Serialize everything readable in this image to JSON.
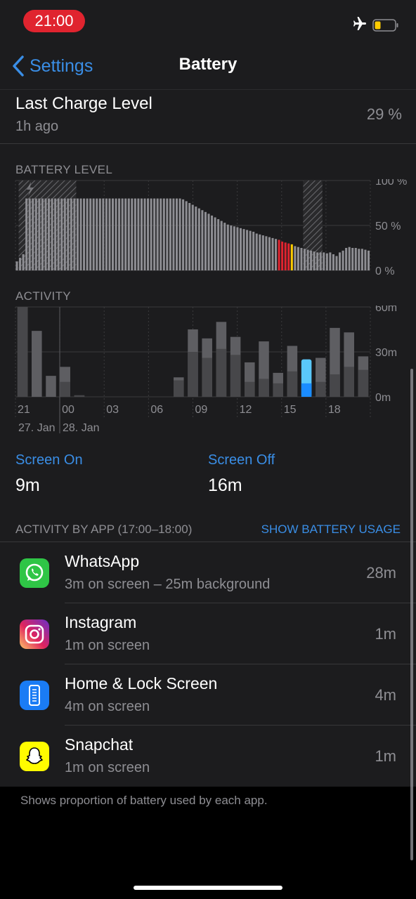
{
  "status": {
    "time": "21:00"
  },
  "nav": {
    "back_label": "Settings",
    "title": "Battery"
  },
  "last_charge": {
    "title": "Last Charge Level",
    "subtitle": "1h ago",
    "value": "29 %"
  },
  "battery_level": {
    "label": "BATTERY LEVEL",
    "y_ticks": [
      "100 %",
      "50 %",
      "0 %"
    ],
    "normal_color": "#8e8e93",
    "low_color": "#e0242f",
    "low_accent_color": "#ffcc00"
  },
  "activity": {
    "label": "ACTIVITY",
    "y_ticks": [
      "60m",
      "30m",
      "0m"
    ],
    "x_labels": [
      "21",
      "00",
      "03",
      "06",
      "09",
      "12",
      "15",
      "18"
    ],
    "date_labels": [
      "27. Jan",
      "28. Jan"
    ],
    "highlight_color": "#5ac8fa",
    "highlight_dark_color": "#1a8cff"
  },
  "chart_data": [
    {
      "type": "bar",
      "title": "BATTERY LEVEL",
      "ylim": [
        0,
        100
      ],
      "y_ticks": [
        "100 %",
        "50 %",
        "0 %"
      ],
      "values": [
        10,
        14,
        18,
        80,
        80,
        80,
        80,
        80,
        80,
        80,
        80,
        80,
        80,
        80,
        80,
        80,
        80,
        80,
        80,
        80,
        80,
        80,
        80,
        80,
        80,
        80,
        80,
        80,
        80,
        80,
        80,
        80,
        80,
        80,
        80,
        80,
        80,
        80,
        80,
        80,
        80,
        80,
        80,
        80,
        80,
        80,
        80,
        80,
        80,
        80,
        80,
        80,
        79,
        77,
        75,
        73,
        71,
        69,
        67,
        65,
        63,
        61,
        59,
        57,
        55,
        53,
        51,
        50,
        49,
        48,
        47,
        46,
        45,
        44,
        43,
        41,
        40,
        39,
        38,
        37,
        36,
        35,
        34,
        32,
        31,
        30,
        29,
        27,
        26,
        25,
        24,
        23,
        22,
        21,
        20,
        20,
        20,
        19,
        20,
        18,
        16,
        20,
        22,
        25,
        26,
        25,
        25,
        24,
        24,
        23,
        22
      ],
      "charging_ranges": [
        [
          1,
          18
        ],
        [
          90,
          95
        ]
      ],
      "low_range": [
        82,
        86
      ]
    },
    {
      "type": "bar",
      "title": "ACTIVITY",
      "ylim": [
        0,
        60
      ],
      "y_ticks": [
        "60m",
        "30m",
        "0m"
      ],
      "x_tick_labels": [
        "21",
        "00",
        "03",
        "06",
        "09",
        "12",
        "15",
        "18"
      ],
      "series": [
        {
          "name": "Screen On",
          "values": [
            60,
            0,
            0,
            10,
            1,
            0,
            0,
            0,
            0,
            0,
            0,
            11,
            30,
            26,
            32,
            28,
            10,
            12,
            9,
            17,
            0,
            10,
            15,
            20,
            18
          ]
        },
        {
          "name": "Screen Off",
          "values": [
            0,
            44,
            14,
            10,
            0,
            0,
            0,
            0,
            0,
            0,
            0,
            2,
            15,
            13,
            18,
            12,
            13,
            25,
            7,
            17,
            0,
            16,
            31,
            23,
            9
          ]
        }
      ],
      "highlighted_hour_index": 20,
      "highlighted_hour": {
        "on": 9,
        "off": 16
      }
    }
  ],
  "screen_on": {
    "label": "Screen On",
    "value": "9m"
  },
  "screen_off": {
    "label": "Screen Off",
    "value": "16m"
  },
  "activity_by_app": {
    "label": "ACTIVITY BY APP (17:00–18:00)",
    "action": "SHOW BATTERY USAGE",
    "apps": [
      {
        "name": "WhatsApp",
        "detail": "3m on screen – 25m background",
        "time": "28m",
        "icon": "whatsapp-icon",
        "color": "#2fc546"
      },
      {
        "name": "Instagram",
        "detail": "1m on screen",
        "time": "1m",
        "icon": "instagram-icon",
        "color": "#c13584"
      },
      {
        "name": "Home & Lock Screen",
        "detail": "4m on screen",
        "time": "4m",
        "icon": "phone-screen-icon",
        "color": "#1a7cf5"
      },
      {
        "name": "Snapchat",
        "detail": "1m on screen",
        "time": "1m",
        "icon": "snapchat-icon",
        "color": "#fffc00"
      }
    ]
  },
  "footer": {
    "note": "Shows proportion of battery used by each app."
  }
}
